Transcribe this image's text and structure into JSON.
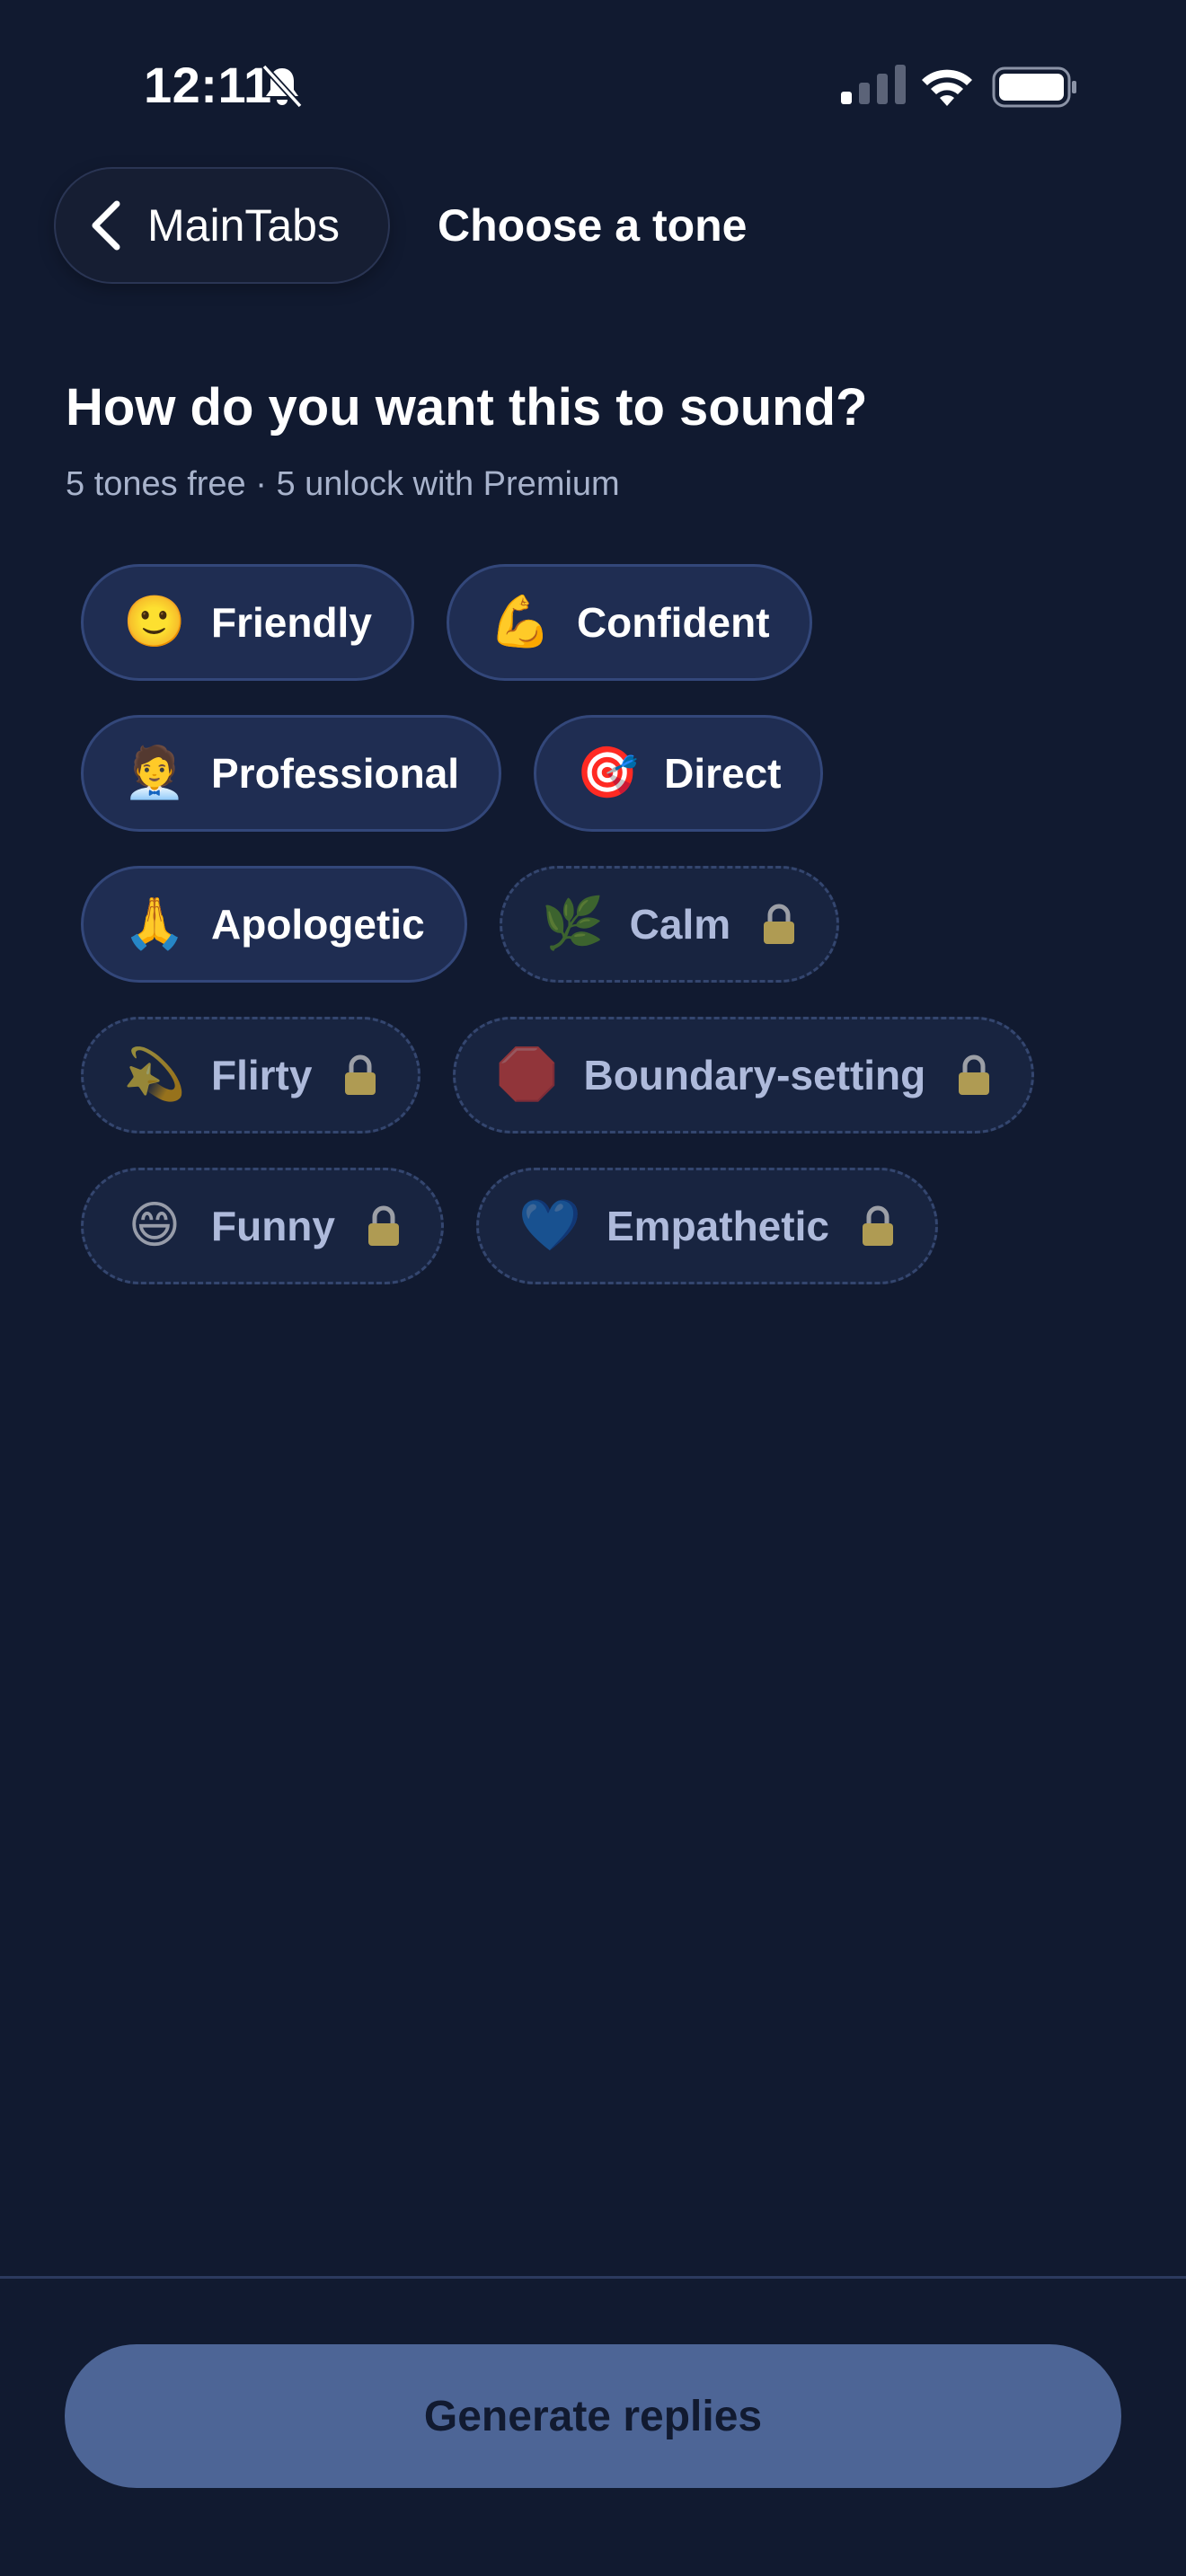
{
  "status_bar": {
    "time": "12:11"
  },
  "nav": {
    "back_label": "MainTabs",
    "title": "Choose a tone"
  },
  "heading": {
    "question": "How do you want this to sound?",
    "subtitle": "5 tones free · 5 unlock with Premium"
  },
  "tones": [
    {
      "label": "Friendly",
      "emoji": "🙂",
      "locked": false
    },
    {
      "label": "Confident",
      "emoji": "💪",
      "locked": false
    },
    {
      "label": "Professional",
      "emoji": "🧑‍💼",
      "locked": false
    },
    {
      "label": "Direct",
      "emoji": "🎯",
      "locked": false
    },
    {
      "label": "Apologetic",
      "emoji": "🙏",
      "locked": false
    },
    {
      "label": "Calm",
      "emoji": "🌿",
      "locked": true
    },
    {
      "label": "Flirty",
      "emoji": "💫",
      "locked": true
    },
    {
      "label": "Boundary-setting",
      "emoji": "🛑",
      "locked": true
    },
    {
      "label": "Funny",
      "emoji": "😄",
      "locked": true
    },
    {
      "label": "Empathetic",
      "emoji": "💙",
      "locked": true
    }
  ],
  "footer": {
    "generate_label": "Generate replies"
  },
  "colors": {
    "background": "#111a30",
    "chip_unlocked": "#1f2d52",
    "chip_locked": "#182440",
    "button": "#4d6596"
  }
}
